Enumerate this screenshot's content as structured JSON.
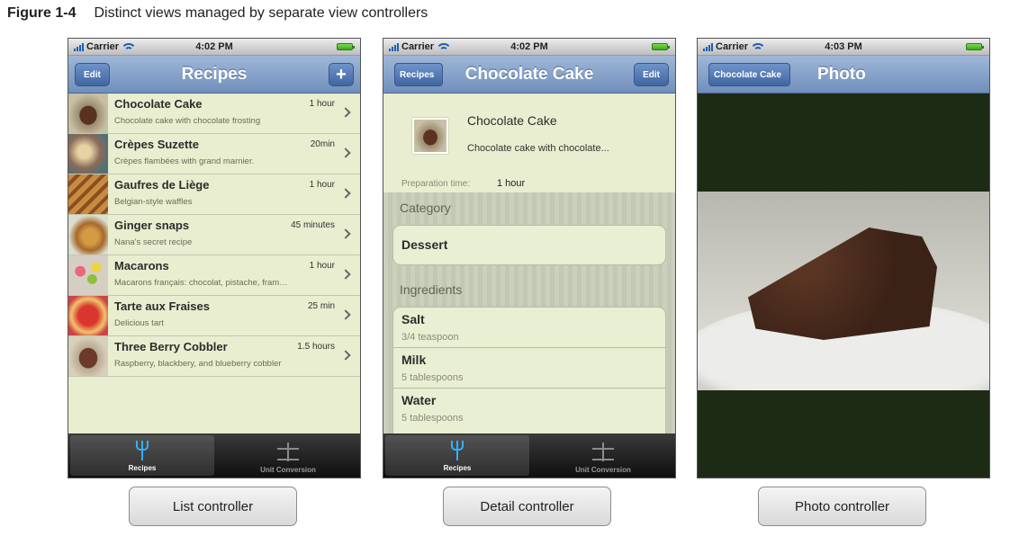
{
  "figure": {
    "label": "Figure 1-4",
    "title": "Distinct views managed by separate view controllers"
  },
  "list_screen": {
    "status": {
      "carrier": "Carrier",
      "time": "4:02 PM"
    },
    "nav": {
      "title": "Recipes",
      "edit_label": "Edit",
      "add_label": "+"
    },
    "recipes": [
      {
        "name": "Chocolate Cake",
        "description": "Chocolate cake with chocolate frosting",
        "time": "1 hour"
      },
      {
        "name": "Crèpes Suzette",
        "description": "Crèpes flambées with grand marnier.",
        "time": "20min"
      },
      {
        "name": "Gaufres de Liège",
        "description": "Belgian-style waffles",
        "time": "1 hour"
      },
      {
        "name": "Ginger snaps",
        "description": "Nana's secret recipe",
        "time": "45 minutes"
      },
      {
        "name": "Macarons",
        "description": "Macarons français: chocolat, pistache, fram…",
        "time": "1 hour"
      },
      {
        "name": "Tarte aux Fraises",
        "description": "Delicious tart",
        "time": "25 min"
      },
      {
        "name": "Three Berry Cobbler",
        "description": "Raspberry, blackbery, and blueberry cobbler",
        "time": "1.5 hours"
      }
    ],
    "tabs": [
      {
        "label": "Recipes",
        "icon": "fork-icon"
      },
      {
        "label": "Unit Conversion",
        "icon": "scale-icon"
      }
    ]
  },
  "detail_screen": {
    "status": {
      "carrier": "Carrier",
      "time": "4:02 PM"
    },
    "nav": {
      "back_label": "Recipes",
      "title": "Chocolate Cake",
      "edit_label": "Edit"
    },
    "recipe_name": "Chocolate Cake",
    "recipe_description": "Chocolate cake with chocolate...",
    "prep_label": "Preparation time:",
    "prep_value": "1 hour",
    "category_title": "Category",
    "category_value": "Dessert",
    "ingredients_title": "Ingredients",
    "ingredients": [
      {
        "name": "Salt",
        "amount": "3/4 teaspoon"
      },
      {
        "name": "Milk",
        "amount": "5 tablespoons"
      },
      {
        "name": "Water",
        "amount": "5 tablespoons"
      }
    ],
    "tabs": [
      {
        "label": "Recipes",
        "icon": "fork-icon"
      },
      {
        "label": "Unit Conversion",
        "icon": "scale-icon"
      }
    ]
  },
  "photo_screen": {
    "status": {
      "carrier": "Carrier",
      "time": "4:03 PM"
    },
    "nav": {
      "back_label": "Chocolate Cake",
      "title": "Photo"
    }
  },
  "controllers": {
    "list": "List controller",
    "detail": "Detail controller",
    "photo": "Photo controller"
  },
  "colors": {
    "nav_bar": "#7f9cc6",
    "list_background": "#e8eecf",
    "tab_bar": "#1e1e1e",
    "active_tab_icon": "#34b0ff"
  }
}
